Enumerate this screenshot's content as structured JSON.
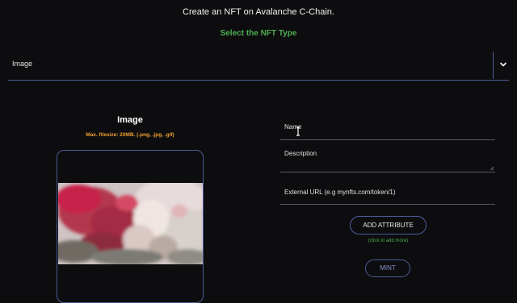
{
  "header": {
    "title": "Create an NFT on Avalanche C-Chain.",
    "section_title": "Select the NFT Type"
  },
  "nft_type_select": {
    "selected": "Image",
    "icon": "chevron-down-icon"
  },
  "upload": {
    "heading": "Image",
    "hint": "Max. filesize: 20MB. (.png, .jpg, .gif)"
  },
  "form": {
    "name_label": "Name",
    "description_label": "Description",
    "external_url_label": "External URL (e.g mynfts.com/token/1)"
  },
  "actions": {
    "add_attribute_label": "ADD ATTRIBUTE",
    "add_attribute_hint": "(click to add more)",
    "mint_label": "MINT"
  },
  "colors": {
    "background": "#0d0d0f",
    "accent_green": "#4caf50",
    "hint_orange": "#f0a030",
    "border_blue": "#4e5a9a"
  }
}
